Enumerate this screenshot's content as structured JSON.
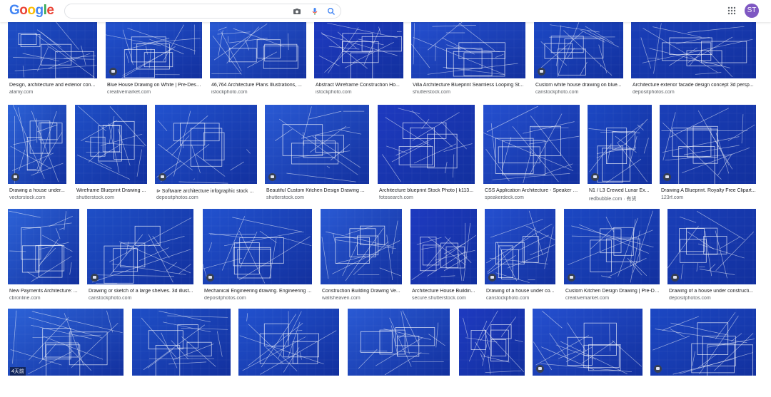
{
  "header": {
    "logo_text": "Google",
    "search_value": "",
    "avatar_letter": "ST"
  },
  "colors": {
    "accent": "#1a73e8",
    "thumb_blue": "#1f3fb8",
    "avatar": "#7e57c2"
  },
  "icons": [
    "camera-icon",
    "mic-icon",
    "search-icon",
    "apps-grid-icon"
  ],
  "results": [
    {
      "title": "Design, architecture and exterior con...",
      "source": "alamy.com"
    },
    {
      "title": "Blue House Drawing on White | Pre-Desig...",
      "source": "creativemarket.com"
    },
    {
      "title": "46,764 Architecture Plans Illustrations, ...",
      "source": "istockphoto.com"
    },
    {
      "title": "Abstract Wireframe Construction Ho...",
      "source": "istockphoto.com"
    },
    {
      "title": "Villa Architecture Blueprint Seamless Looping St...",
      "source": "shutterstock.com"
    },
    {
      "title": "Custom white house drawing on blue...",
      "source": "canstockphoto.com"
    },
    {
      "title": "Architecture exterior facade design concept 3d persp...",
      "source": "depositphotos.com"
    },
    {
      "title": "Drawing a house under...",
      "source": "vectorstock.com"
    },
    {
      "title": "Wireframe Blueprint Drawing ...",
      "source": "shutterstock.com"
    },
    {
      "title": "⊳ Software architecture infographic stock ...",
      "source": "depositphotos.com"
    },
    {
      "title": "Beautiful Custom Kitchen Design Drawing ...",
      "source": "shutterstock.com"
    },
    {
      "title": "Architecture blueprint Stock Photo | k113...",
      "source": "fotosearch.com"
    },
    {
      "title": "CSS Application Architecture - Speaker D...",
      "source": "speakerdeck.com"
    },
    {
      "title": "N1 / L3 Crewed Lunar Ex...",
      "source": "redbubble.com · 有货"
    },
    {
      "title": "Drawing A Blueprint. Royalty Free Clipart...",
      "source": "123rf.com"
    },
    {
      "title": "New Payments Architecture: ...",
      "source": "cbronline.com"
    },
    {
      "title": "Drawing or sketch of a large shelves. 3d illust...",
      "source": "canstockphoto.com"
    },
    {
      "title": "Mechanical Engineering drawing. Engineering ...",
      "source": "depositphotos.com"
    },
    {
      "title": "Construction Building Drawing Ve...",
      "source": "wallsheaven.com"
    },
    {
      "title": "Architecture House Buildin...",
      "source": "secure.shutterstock.com"
    },
    {
      "title": "Drawing of a house under co...",
      "source": "canstockphoto.com"
    },
    {
      "title": "Custom Kitchen Design Drawing | Pre-De...",
      "source": "creativemarket.com"
    },
    {
      "title": "Drawing of a house under constructi...",
      "source": "depositphotos.com"
    },
    {
      "title": "",
      "source": ""
    },
    {
      "title": "",
      "source": ""
    },
    {
      "title": "",
      "source": ""
    },
    {
      "title": "",
      "source": ""
    },
    {
      "title": "",
      "source": ""
    },
    {
      "title": "",
      "source": ""
    },
    {
      "title": "",
      "source": ""
    }
  ],
  "overlay_label": "4天前"
}
